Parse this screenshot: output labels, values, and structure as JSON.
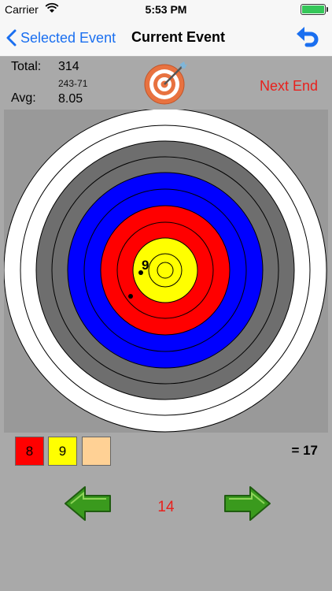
{
  "status_bar": {
    "carrier": "Carrier",
    "time": "5:53 PM",
    "battery_level": 1.0
  },
  "nav": {
    "back_label": "Selected Event",
    "title": "Current Event"
  },
  "stats": {
    "total_label": "Total:",
    "total_value": "314",
    "detail": "243-71",
    "avg_label": "Avg:",
    "avg_value": "8.05",
    "next_end_label": "Next End"
  },
  "target": {
    "arrows": [
      {
        "score": "9",
        "label_shown": "9"
      },
      {
        "score": "8",
        "label_shown": ""
      }
    ]
  },
  "scores": {
    "arrows": [
      {
        "value": "8",
        "color": "#ff0000"
      },
      {
        "value": "9",
        "color": "#ffff00"
      },
      {
        "value": "",
        "color": "#ffd195"
      }
    ],
    "sum": "= 17"
  },
  "end_nav": {
    "end_number": "14"
  },
  "colors": {
    "accent_blue": "#1a6ff0",
    "accent_red": "#e8211d",
    "ring_white": "#ffffff",
    "ring_black": "#6e6e6e",
    "ring_blue": "#0000ff",
    "ring_red": "#ff0000",
    "ring_gold": "#ffff00",
    "arrow_green": "#3a9a1d"
  }
}
